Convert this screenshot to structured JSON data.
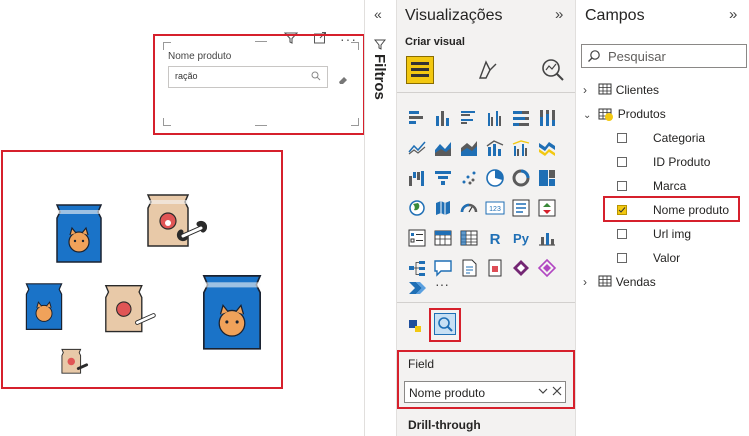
{
  "canvas": {
    "slicer": {
      "title": "Nome produto",
      "search_value": "ração"
    },
    "header_icons": [
      "filter-icon",
      "focus-mode-icon",
      "more-options-icon"
    ]
  },
  "filters": {
    "label": "Filtros"
  },
  "visualizations": {
    "title": "Visualizações",
    "build_visual_label": "Criar visual",
    "well": {
      "label": "Field",
      "value": "Nome produto"
    },
    "drillthrough_label": "Drill-through",
    "more_label": "···"
  },
  "fields": {
    "title": "Campos",
    "search_placeholder": "Pesquisar",
    "tables": [
      {
        "name": "Clientes",
        "expanded": false
      },
      {
        "name": "Produtos",
        "expanded": true,
        "columns": [
          {
            "name": "Categoria",
            "checked": false
          },
          {
            "name": "ID Produto",
            "checked": false
          },
          {
            "name": "Marca",
            "checked": false
          },
          {
            "name": "Nome produto",
            "checked": true
          },
          {
            "name": "Url img",
            "checked": false
          },
          {
            "name": "Valor",
            "checked": false
          }
        ]
      },
      {
        "name": "Vendas",
        "expanded": false
      }
    ]
  },
  "colors": {
    "accent_red": "#d6202c",
    "check_yellow": "#f2c811",
    "pane_bg": "#f3f2f1",
    "bag_blue": "#1a73c8",
    "bag_beige": "#e8c9a8"
  }
}
